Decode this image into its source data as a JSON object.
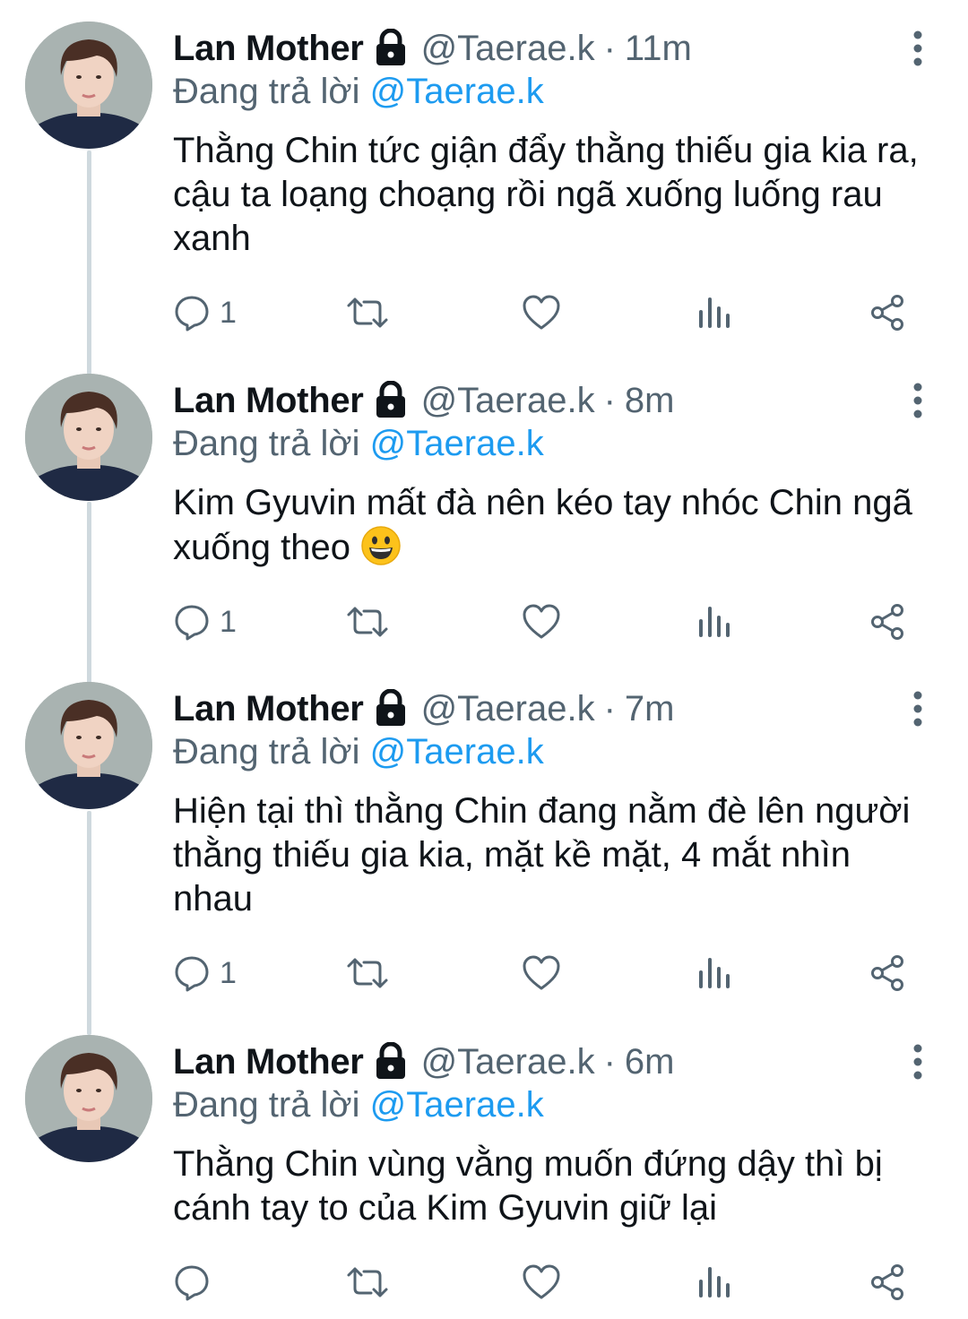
{
  "tweets": [
    {
      "name": "Lan Mother",
      "handle": "@Taerae.k",
      "separator": "·",
      "time": "11m",
      "replying_prefix": "Đang trả lời",
      "replying_to": "@Taerae.k",
      "text": "Thằng Chin tức giận đẩy thằng thiếu gia kia ra, cậu ta loạng choạng rồi ngã xuống luống rau xanh",
      "reply_count": "1"
    },
    {
      "name": "Lan Mother",
      "handle": "@Taerae.k",
      "separator": "·",
      "time": "8m",
      "replying_prefix": "Đang trả lời",
      "replying_to": "@Taerae.k",
      "text": "Kim Gyuvin mất đà nên kéo tay nhóc Chin ngã xuống theo",
      "emoji": "grinning-face",
      "reply_count": "1"
    },
    {
      "name": "Lan Mother",
      "handle": "@Taerae.k",
      "separator": "·",
      "time": "7m",
      "replying_prefix": "Đang trả lời",
      "replying_to": "@Taerae.k",
      "text": "Hiện tại thì thằng Chin đang nằm đè lên người thằng thiếu gia kia, mặt kề mặt, 4 mắt nhìn nhau",
      "reply_count": "1"
    },
    {
      "name": "Lan Mother",
      "handle": "@Taerae.k",
      "separator": "·",
      "time": "6m",
      "replying_prefix": "Đang trả lời",
      "replying_to": "@Taerae.k",
      "text": "Thằng Chin vùng vằng muốn đứng dậy thì bị cánh tay to của Kim Gyuvin giữ lại",
      "reply_count": ""
    }
  ],
  "icons": {
    "lock": "lock-icon",
    "more": "more-vertical-icon",
    "reply": "reply-icon",
    "retweet": "retweet-icon",
    "like": "heart-icon",
    "views": "analytics-icon",
    "share": "share-icon"
  },
  "colors": {
    "text": "#0f1419",
    "secondary": "#536471",
    "link": "#1d9bf0",
    "thread_line": "#cfd9de"
  }
}
